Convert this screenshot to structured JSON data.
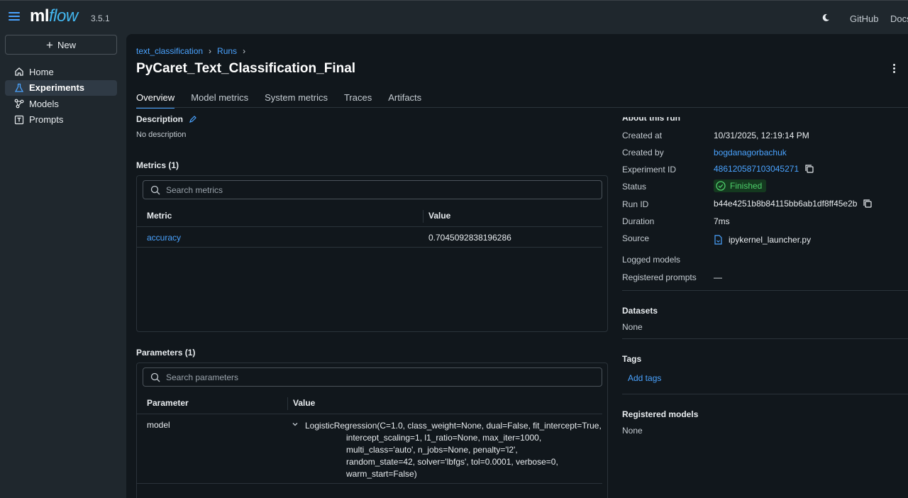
{
  "header": {
    "logo_ml": "ml",
    "logo_flow": "flow",
    "version": "3.5.1",
    "github": "GitHub",
    "docs": "Docs"
  },
  "sidebar": {
    "new_label": "New",
    "items": [
      {
        "label": "Home",
        "icon": "home-icon",
        "active": false
      },
      {
        "label": "Experiments",
        "icon": "beaker-icon",
        "active": true
      },
      {
        "label": "Models",
        "icon": "models-icon",
        "active": false
      },
      {
        "label": "Prompts",
        "icon": "prompt-icon",
        "active": false
      }
    ]
  },
  "breadcrumb": {
    "experiment": "text_classification",
    "runs": "Runs",
    "sep": "›"
  },
  "run": {
    "title": "PyCaret_Text_Classification_Final"
  },
  "tabs": [
    "Overview",
    "Model metrics",
    "System metrics",
    "Traces",
    "Artifacts"
  ],
  "description": {
    "title": "Description",
    "text": "No description"
  },
  "metrics": {
    "title": "Metrics (1)",
    "search_placeholder": "Search metrics",
    "col_metric": "Metric",
    "col_value": "Value",
    "rows": [
      {
        "name": "accuracy",
        "value": "0.7045092838196286"
      }
    ]
  },
  "parameters": {
    "title": "Parameters (1)",
    "search_placeholder": "Search parameters",
    "col_param": "Parameter",
    "col_value": "Value",
    "rows": [
      {
        "name": "model",
        "value_first": "LogisticRegression(C=1.0, class_weight=None, dual=False, fit_intercept=True,",
        "value_lines": [
          "intercept_scaling=1, l1_ratio=None, max_iter=1000,",
          "multi_class='auto', n_jobs=None, penalty='l2',",
          "random_state=42, solver='lbfgs', tol=0.0001, verbose=0,",
          "warm_start=False)"
        ]
      }
    ]
  },
  "about": {
    "title": "About this run",
    "created_at_label": "Created at",
    "created_at": "10/31/2025, 12:19:14 PM",
    "created_by_label": "Created by",
    "created_by": "bogdanagorbachuk",
    "experiment_id_label": "Experiment ID",
    "experiment_id": "486120587103045271",
    "status_label": "Status",
    "status": "Finished",
    "run_id_label": "Run ID",
    "run_id": "b44e4251b8b84115bb6ab1df8ff45e2b",
    "duration_label": "Duration",
    "duration": "7ms",
    "source_label": "Source",
    "source": "ipykernel_launcher.py",
    "logged_models_label": "Logged models",
    "registered_prompts_label": "Registered prompts",
    "registered_prompts": "—"
  },
  "datasets": {
    "title": "Datasets",
    "value": "None"
  },
  "tags": {
    "title": "Tags",
    "add_label": "Add tags"
  },
  "registered_models": {
    "title": "Registered models",
    "value": "None"
  },
  "colors": {
    "accent": "#4aa3ff",
    "status_green": "#4ecf6b",
    "background": "#11171c",
    "chrome": "#1f272d"
  }
}
